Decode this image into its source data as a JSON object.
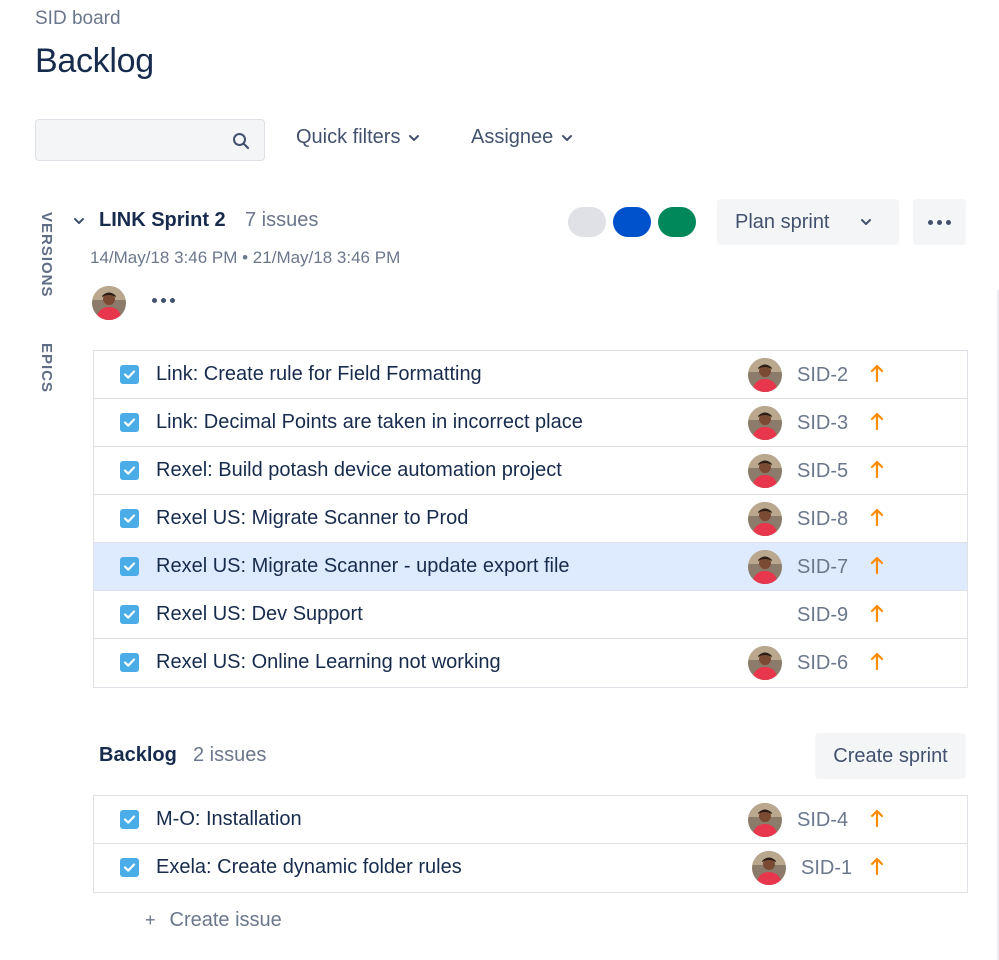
{
  "header": {
    "breadcrumb": "SID board",
    "title": "Backlog"
  },
  "filters": {
    "search_value": "",
    "quick_filters_label": "Quick filters",
    "assignee_label": "Assignee"
  },
  "side_tabs": {
    "versions": "VERSIONS",
    "epics": "EPICS"
  },
  "sprint": {
    "name": "LINK Sprint 2",
    "issue_count": "7 issues",
    "dates": "14/May/18 3:46 PM • 21/May/18 3:46 PM",
    "status_colors": {
      "todo": "#dfe1e6",
      "in_progress": "#0052cc",
      "done": "#00875a"
    },
    "plan_sprint_label": "Plan sprint",
    "issues": [
      {
        "summary": "Link: Create rule for Field Formatting",
        "key": "SID-2",
        "assigned": true,
        "selected": false
      },
      {
        "summary": "Link: Decimal Points are taken in incorrect place",
        "key": "SID-3",
        "assigned": true,
        "selected": false
      },
      {
        "summary": "Rexel: Build potash device automation project",
        "key": "SID-5",
        "assigned": true,
        "selected": false
      },
      {
        "summary": "Rexel US: Migrate Scanner to Prod",
        "key": "SID-8",
        "assigned": true,
        "selected": false
      },
      {
        "summary": "Rexel US: Migrate Scanner - update export file",
        "key": "SID-7",
        "assigned": true,
        "selected": true
      },
      {
        "summary": "Rexel US: Dev Support",
        "key": "SID-9",
        "assigned": false,
        "selected": false
      },
      {
        "summary": "Rexel US: Online Learning not working",
        "key": "SID-6",
        "assigned": true,
        "selected": false
      }
    ]
  },
  "backlog": {
    "title": "Backlog",
    "issue_count": "2 issues",
    "create_sprint_label": "Create sprint",
    "issues": [
      {
        "summary": "M-O: Installation",
        "key": "SID-4",
        "assigned": true,
        "selected": false
      },
      {
        "summary": "Exela: Create dynamic folder rules",
        "key": "SID-1",
        "assigned": true,
        "selected": false
      }
    ],
    "create_issue_label": "Create issue"
  },
  "colors": {
    "priority_high": "#ff8b00",
    "issue_type_task": "#4bade8",
    "selected_row": "#deebff"
  },
  "icons": {
    "search": "search-icon",
    "chevron": "chevron-down-icon",
    "priority": "priority-high-arrow-icon",
    "issue_type": "checkbox-task-icon",
    "more": "more-icon",
    "plus": "plus-icon"
  }
}
